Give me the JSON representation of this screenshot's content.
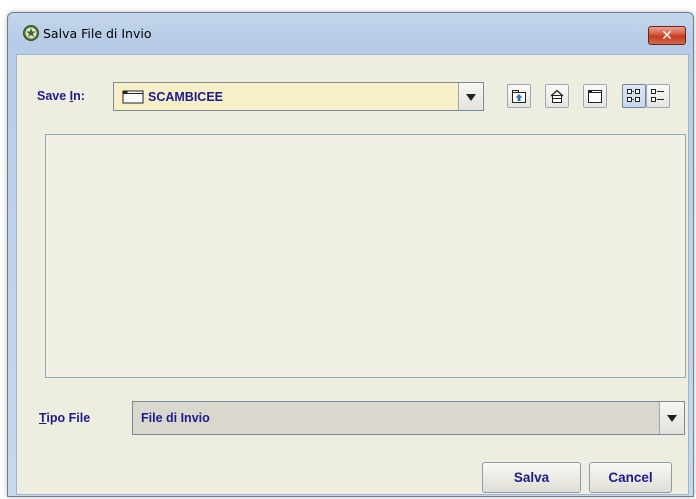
{
  "window": {
    "title": "Salva File di Invio",
    "close_glyph": "✕"
  },
  "save_in": {
    "label_prefix": "Save ",
    "label_mnemonic": "I",
    "label_suffix": "n:",
    "value": "SCAMBICEE",
    "folder_icon": "folder-icon"
  },
  "toolbar": {
    "icons": [
      "up-one-level-icon",
      "home-icon",
      "new-folder-icon",
      "list-view-icon",
      "details-view-icon"
    ]
  },
  "file_type": {
    "label_mnemonic": "T",
    "label_rest": "ipo File",
    "value": "File di Invio"
  },
  "buttons": {
    "save": "Salva",
    "cancel": "Cancel"
  },
  "colors": {
    "title_bar": "#b9cde7",
    "client_bg": "#eeeee0",
    "label_text": "#1c1c8c",
    "combo_bg": "#f6efc8",
    "close_button": "#c43a1f"
  }
}
